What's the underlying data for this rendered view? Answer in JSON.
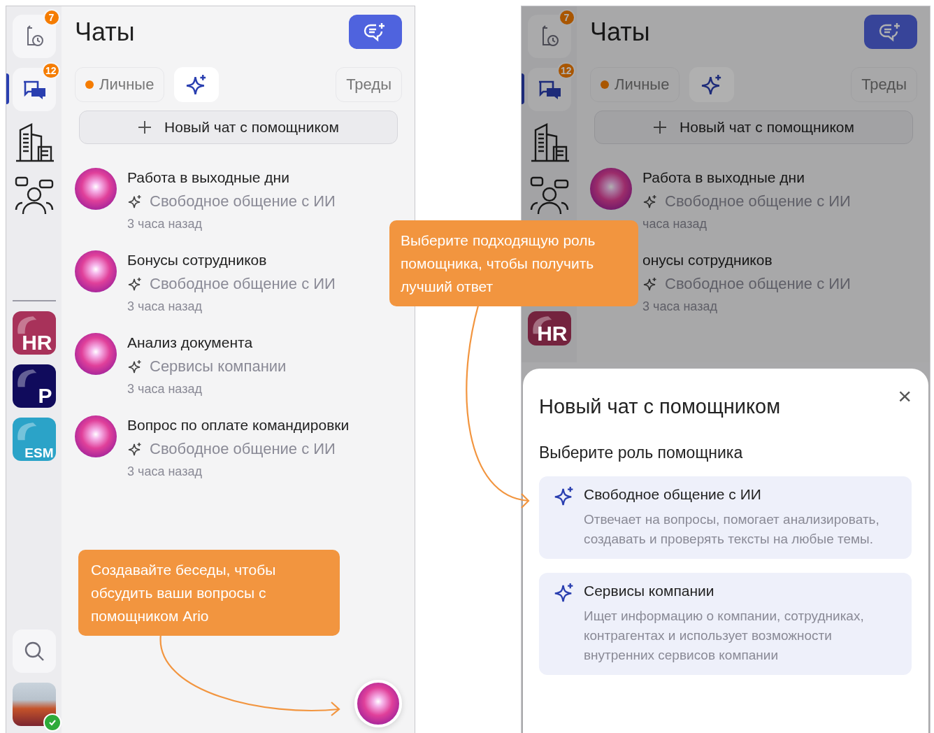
{
  "screens": [
    {
      "dimmed": false,
      "sidebar": {
        "top": [
          {
            "kind": "history",
            "badge": "7",
            "selected": false
          },
          {
            "kind": "chats",
            "badge": "12",
            "selected": true
          },
          {
            "kind": "buildings",
            "selected": false
          },
          {
            "kind": "people",
            "selected": false
          }
        ],
        "apps": [
          {
            "label": "HR",
            "color": "#a8325a"
          },
          {
            "label": "P",
            "color": "#100b5c"
          },
          {
            "label": "ESM",
            "color": "#2ba3c8"
          }
        ],
        "bottom": [
          {
            "kind": "search"
          },
          {
            "kind": "profile",
            "online": true
          }
        ]
      },
      "title": "Чаты",
      "tabs": [
        {
          "label": "Личные",
          "unread": true,
          "selected": false
        },
        {
          "kind": "assistant",
          "selected": true
        },
        {
          "label": "Треды",
          "selected": false
        }
      ],
      "new_chat_button": "Новый чат с помощником",
      "chats": [
        {
          "title": "Работа в выходные дни",
          "role": "Свободное общение с ИИ",
          "time": "3 часа назад"
        },
        {
          "title": "Бонусы сотрудников",
          "role": "Свободное общение с ИИ",
          "time": "3 часа назад"
        },
        {
          "title": "Анализ документа",
          "role": "Сервисы компании",
          "time": "3 часа назад"
        },
        {
          "title": "Вопрос по оплате командировки",
          "role": "Свободное общение с ИИ",
          "time": "3 часа назад"
        }
      ],
      "assistant_button": true
    },
    {
      "dimmed": true,
      "sidebar": {
        "top": [
          {
            "kind": "history",
            "badge": "7",
            "selected": false
          },
          {
            "kind": "chats",
            "badge": "12",
            "selected": true
          },
          {
            "kind": "buildings",
            "selected": false
          },
          {
            "kind": "people",
            "selected": false
          }
        ],
        "apps": [
          {
            "label": "HR",
            "color": "#74233e"
          }
        ]
      },
      "title": "Чаты",
      "tabs": [
        {
          "label": "Личные",
          "unread": true,
          "selected": false
        },
        {
          "kind": "assistant",
          "selected": true
        },
        {
          "label": "Треды",
          "selected": false
        }
      ],
      "new_chat_button": "Новый чат с помощником",
      "chats": [
        {
          "title": "Работа в выходные дни",
          "role": "Свободное общение с ИИ",
          "time": "часа назад"
        },
        {
          "title": "онусы сотрудников",
          "role": "Свободное общение с ИИ",
          "time": "3 часа назад"
        }
      ],
      "dialog": {
        "title": "Новый чат с помощником",
        "close": "×",
        "subtitle": "Выберите роль помощника",
        "roles": [
          {
            "title": "Свободное общение с ИИ",
            "description": "Отвечает на вопросы, помогает анализировать, создавать и проверять тексты на любые темы."
          },
          {
            "title": "Сервисы компании",
            "description": "Ищет информацию о компании, сотрудниках, контрагентах и использует возможности внутренних сервисов компании"
          }
        ]
      }
    }
  ],
  "callouts": [
    {
      "text": "Создавайте беседы, чтобы обсудить ваши вопросы с помощником Ario"
    },
    {
      "text": "Выберите подходящую роль помощника, чтобы получить лучший ответ"
    }
  ]
}
